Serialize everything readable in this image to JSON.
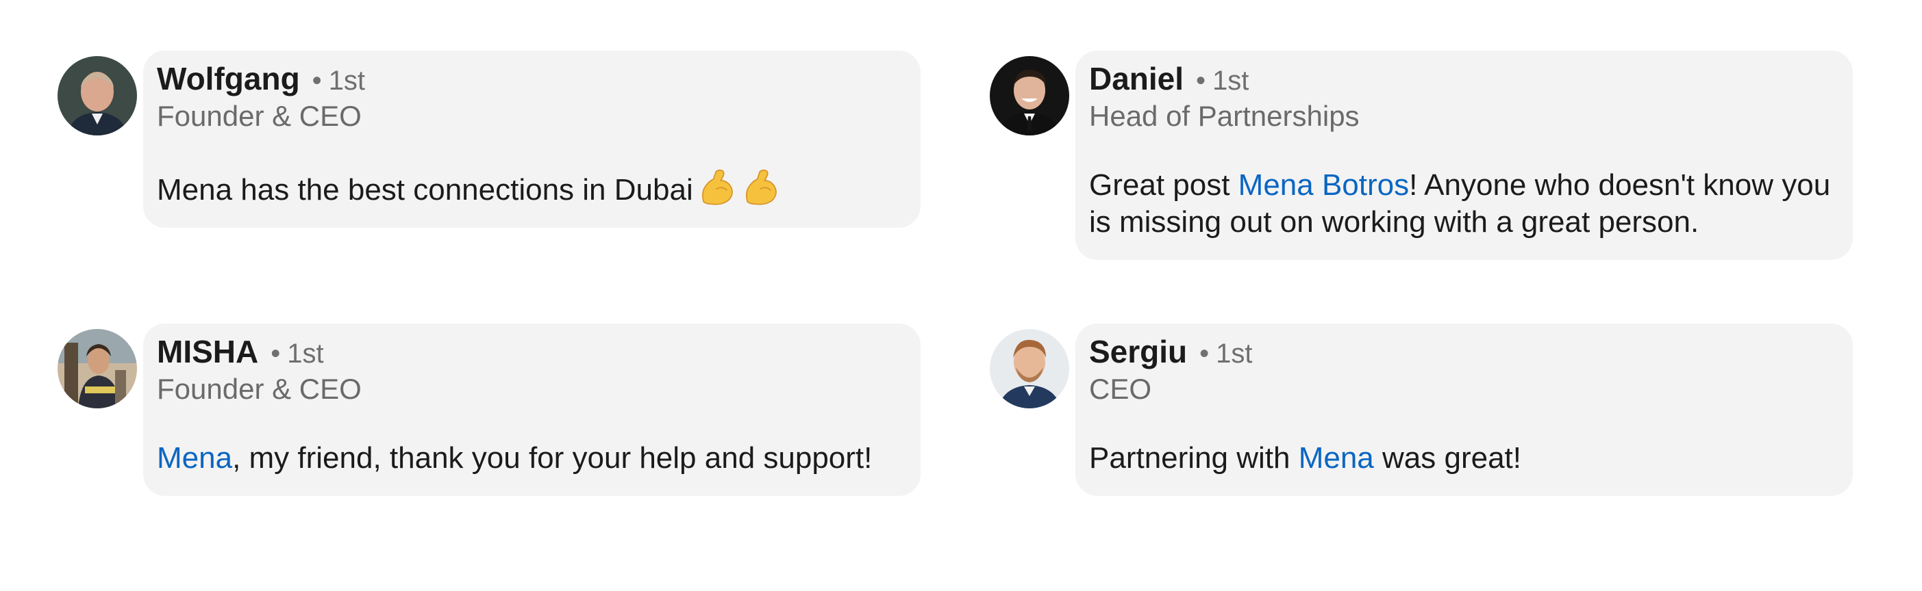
{
  "colors": {
    "bubble_bg": "#f3f3f3",
    "mention": "#0a66c2",
    "meta_text": "#6a6a6a",
    "emoji": "#f6c23e"
  },
  "comments": [
    {
      "author": "Wolfgang",
      "degree": "1st",
      "headline": "Founder & CEO",
      "text_before": "Mena has the best connections in Dubai",
      "emoji": [
        "flexed-biceps-icon",
        "flexed-biceps-icon"
      ]
    },
    {
      "author": "Daniel",
      "degree": "1st",
      "headline": "Head of Partnerships",
      "text_before": "Great post ",
      "mention": "Mena Botros",
      "text_after": "! Anyone who doesn't know you is missing out on working with a great person."
    },
    {
      "author": "MISHA",
      "degree": "1st",
      "headline": "Founder & CEO",
      "mention": "Mena",
      "text_after": ", my friend, thank you for your help and support!"
    },
    {
      "author": "Sergiu",
      "degree": "1st",
      "headline": "CEO",
      "text_before": "Partnering with ",
      "mention": "Mena",
      "text_after": " was great!"
    }
  ]
}
